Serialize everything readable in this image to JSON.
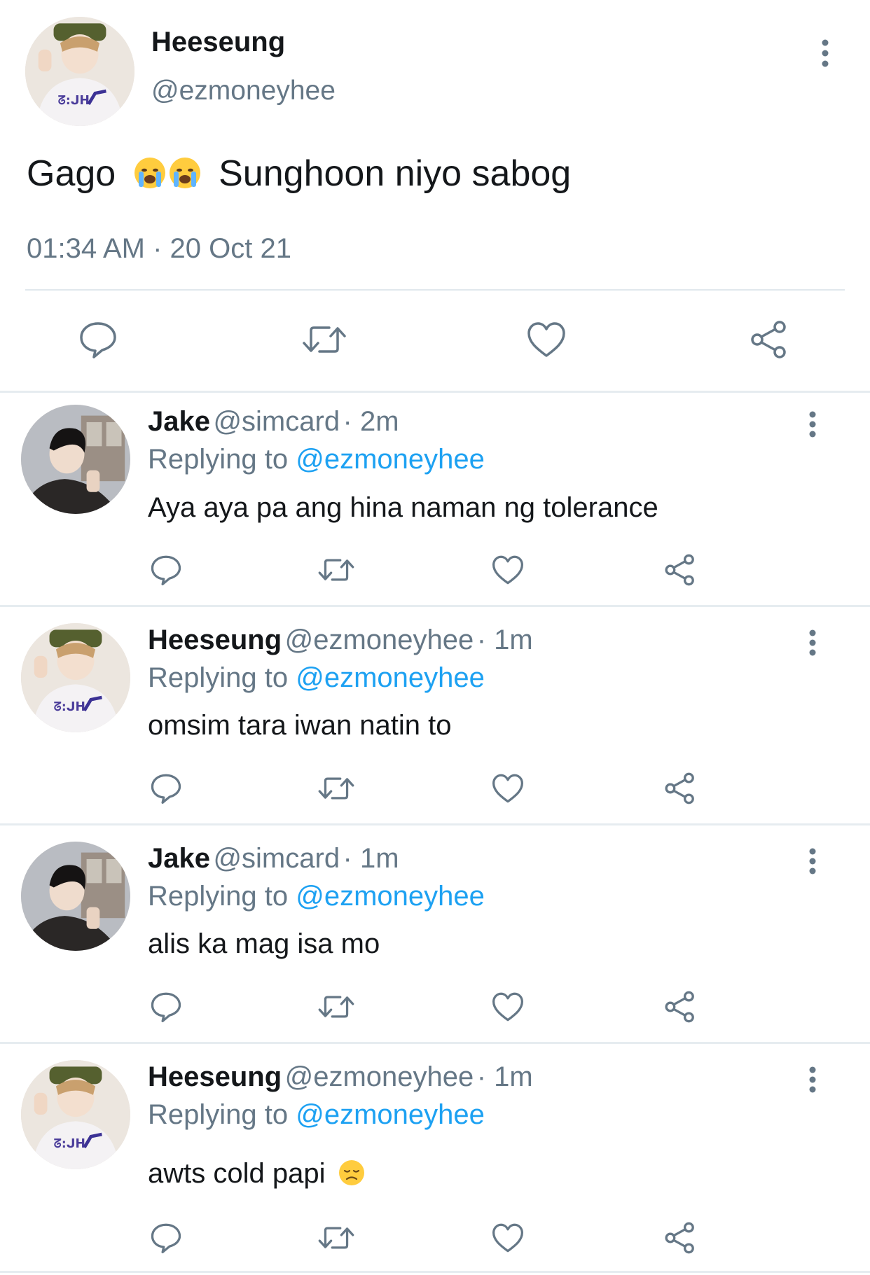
{
  "main_tweet": {
    "name": "Heeseung",
    "handle": "@ezmoneyhee",
    "text_before": "Gago",
    "emojis": [
      "😭",
      "😭"
    ],
    "text_after": "Sunghoon niyo sabog",
    "timestamp": "01:34 AM · 20 Oct 21"
  },
  "replies": [
    {
      "name": "Jake",
      "handle": "@simcard",
      "time": "· 2m",
      "replying_prefix": "Replying to",
      "replying_to": "@ezmoneyhee",
      "text": "Aya aya pa ang hina naman ng tolerance"
    },
    {
      "name": "Heeseung",
      "handle": "@ezmoneyhee",
      "time": "· 1m",
      "replying_prefix": "Replying to",
      "replying_to": "@ezmoneyhee",
      "text": "omsim tara iwan natin to"
    },
    {
      "name": "Jake",
      "handle": "@simcard",
      "time": "· 1m",
      "replying_prefix": "Replying to",
      "replying_to": "@ezmoneyhee",
      "text": "alis ka mag isa mo"
    },
    {
      "name": "Heeseung",
      "handle": "@ezmoneyhee",
      "time": "· 1m",
      "replying_prefix": "Replying to",
      "replying_to": "@ezmoneyhee",
      "text": "awts cold papi",
      "emoji": "😞"
    }
  ],
  "icons": {
    "reply": "comment-icon",
    "retweet": "retweet-icon",
    "like": "heart-icon",
    "share": "share-icon",
    "more": "more-vertical-icon"
  },
  "colors": {
    "text": "#14171a",
    "muted": "#657786",
    "link": "#1da1f2",
    "divider": "#e6ecf0"
  }
}
